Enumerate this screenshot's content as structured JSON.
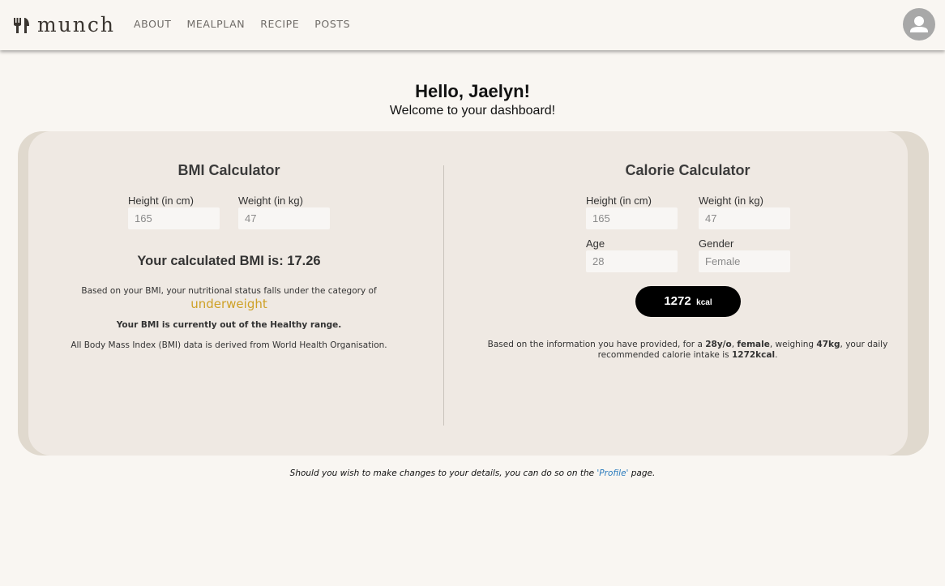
{
  "nav": {
    "brand": "munch",
    "links": [
      "ABOUT",
      "MEALPLAN",
      "RECIPE",
      "POSTS"
    ]
  },
  "greeting": {
    "title": "Hello, Jaelyn!",
    "subtitle": "Welcome to your dashboard!"
  },
  "bmi": {
    "title": "BMI Calculator",
    "height_label": "Height (in cm)",
    "height_value": "165",
    "weight_label": "Weight (in kg)",
    "weight_value": "47",
    "result": "Your calculated BMI is: 17.26",
    "category_intro": "Based on your BMI, your nutritional status falls under the category of",
    "category": "underweight",
    "range_note": "Your BMI is currently out of the Healthy range.",
    "source_note": "All Body Mass Index (BMI) data is derived from World Health Organisation."
  },
  "calorie": {
    "title": "Calorie Calculator",
    "height_label": "Height (in cm)",
    "height_value": "165",
    "weight_label": "Weight (in kg)",
    "weight_value": "47",
    "age_label": "Age",
    "age_value": "28",
    "gender_label": "Gender",
    "gender_value": "Female",
    "kcal_value": "1272",
    "kcal_unit": "kcal",
    "summary": {
      "p1": "Based on the information you have provided, for a ",
      "age": "28y/o",
      "p2": ", ",
      "gender": "female",
      "p3": ", weighing ",
      "weight": "47kg",
      "p4": ", your daily",
      "p5": "recommended calorie intake is ",
      "intake": "1272kcal",
      "p6": "."
    }
  },
  "footer": {
    "pre": "Should you wish to make changes to your details, you can do so on the ",
    "link": "'Profile'",
    "post": " page."
  },
  "colors": {
    "background": "#f9f6f2",
    "card_outer": "#e0d9ce",
    "card_inner": "#efe9e3",
    "category": "#cea127",
    "link": "#2a7bbd"
  },
  "icons": {
    "logo": "fork-knife-icon",
    "avatar": "user-avatar-icon"
  }
}
